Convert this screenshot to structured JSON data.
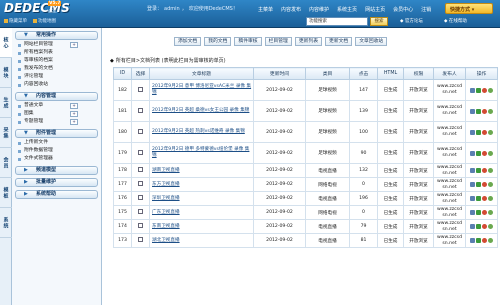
{
  "header": {
    "brand": "DEDECMS",
    "version": "V5.7",
    "brand_sub": "GBK",
    "login_info": [
      "登录：",
      "admin",
      "，",
      "欢迎使用DedeCMS！"
    ],
    "nav": [
      "主菜单",
      "内容发布",
      "内容维护",
      "系统主页",
      "网站主页",
      "会员中心",
      "注销"
    ],
    "quick_button": "快捷方式 ▾",
    "hide_menu": "隐藏菜单",
    "function_map": "功能地图",
    "search_placeholder": "功能搜索",
    "search_button": "搜索",
    "official_forum": "官方论坛",
    "online_help": "在线帮助"
  },
  "vtabs": [
    "核心",
    "模块",
    "生成",
    "采集",
    "会员",
    "模板",
    "系统"
  ],
  "sidebar": {
    "groups": [
      {
        "title": "常用操作",
        "items": [
          {
            "label": "网站栏目管理",
            "add": "+"
          },
          {
            "label": "所有档案列表"
          },
          {
            "label": "等审核的档案"
          },
          {
            "label": "我发布的文档"
          },
          {
            "label": "评论管理"
          },
          {
            "label": "内容回收站"
          }
        ]
      },
      {
        "title": "内容管理",
        "items": [
          {
            "label": "普通文章",
            "add": "+"
          },
          {
            "label": "图集",
            "add": "+"
          },
          {
            "label": "专题管理",
            "add": "+"
          }
        ]
      },
      {
        "title": "附件管理",
        "items": [
          {
            "label": "上传新文件"
          },
          {
            "label": "附件数据管理"
          },
          {
            "label": "文件式管理器"
          }
        ]
      },
      {
        "title": "频道模型",
        "items": []
      },
      {
        "title": "批量维护",
        "items": []
      },
      {
        "title": "系统帮助",
        "items": []
      }
    ]
  },
  "toolbar": [
    "添加文档",
    "我的文档",
    "稿件审核",
    "栏目管理",
    "更新列表",
    "更新文档",
    "文章回收站"
  ],
  "table": {
    "title": "所有栏目>文档列表  (表明此栏目为需审核的单页)",
    "columns": [
      "ID",
      "选择",
      "文章标题",
      "更新时间",
      "类目",
      "点击",
      "HTML",
      "权限",
      "发布人",
      "操作"
    ],
    "rows": [
      {
        "id": "182",
        "title": "2012年9月2日 意甲 博洛尼亚vsAC米兰 录像 集锦",
        "date": "2012-09-02",
        "cat": "足球视频",
        "clicks": "147",
        "html": "已生成",
        "perm": "开放浏览",
        "publisher": "www.zzcsd sn.net"
      },
      {
        "id": "181",
        "title": "2012年9月2日 英超 桑德vs女王公园 录像 集锦",
        "date": "2012-09-02",
        "cat": "足球视频",
        "clicks": "139",
        "html": "已生成",
        "perm": "开放浏览",
        "publisher": "www.zzcsd sn.net"
      },
      {
        "id": "180",
        "title": "2012年9月2日 英超 热刺vs诺维奇 录像 集锦",
        "date": "2012-09-02",
        "cat": "足球视频",
        "clicks": "100",
        "html": "已生成",
        "perm": "开放浏览",
        "publisher": "www.zzcsd sn.net"
      },
      {
        "id": "179",
        "title": "2012年9月2日 德甲 多特蒙德vs纽伦堡 录像 集锦",
        "date": "2012-09-02",
        "cat": "足球视频",
        "clicks": "90",
        "html": "已生成",
        "perm": "开放浏览",
        "publisher": "www.zzcsd sn.net"
      },
      {
        "id": "178",
        "title": "湖南卫视直播",
        "date": "2012-09-02",
        "cat": "电视直播",
        "clicks": "132",
        "html": "已生成",
        "perm": "开放浏览",
        "publisher": "www.zzcsd sn.net"
      },
      {
        "id": "177",
        "title": "东方卫视直播",
        "date": "2012-09-02",
        "cat": "网络电视",
        "clicks": "0",
        "html": "已生成",
        "perm": "开放浏览",
        "publisher": "www.zzcsd sn.net"
      },
      {
        "id": "176",
        "title": "深圳卫视直播",
        "date": "2012-09-02",
        "cat": "电视直播",
        "clicks": "196",
        "html": "已生成",
        "perm": "开放浏览",
        "publisher": "www.zzcsd sn.net"
      },
      {
        "id": "175",
        "title": "广东卫视直播",
        "date": "2012-09-02",
        "cat": "网络电视",
        "clicks": "0",
        "html": "已生成",
        "perm": "开放浏览",
        "publisher": "www.zzcsd sn.net"
      },
      {
        "id": "174",
        "title": "东南卫视直播",
        "date": "2012-09-02",
        "cat": "电视直播",
        "clicks": "79",
        "html": "已生成",
        "perm": "开放浏览",
        "publisher": "www.zzcsd sn.net"
      },
      {
        "id": "173",
        "title": "湖北卫视直播",
        "date": "2012-09-02",
        "cat": "电视直播",
        "clicks": "81",
        "html": "已生成",
        "perm": "开放浏览",
        "publisher": "www.zzcsd sn.net"
      }
    ]
  },
  "colors": {
    "header": "#1b5f98",
    "accent": "#f2b92a",
    "link": "#1d4f87"
  }
}
